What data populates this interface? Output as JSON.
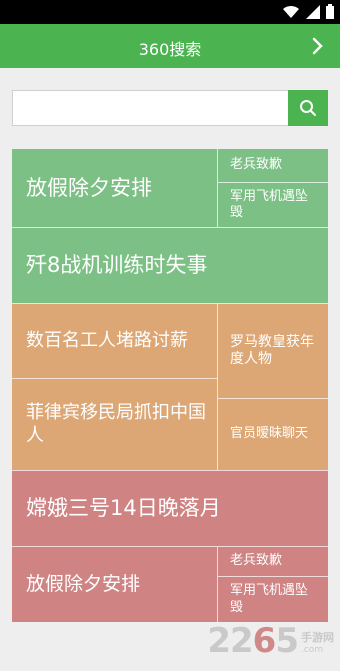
{
  "header": {
    "title": "360搜索"
  },
  "search": {
    "value": "",
    "placeholder": ""
  },
  "tiles": [
    {
      "text": "放假除夕安排"
    },
    {
      "text": "老兵致歉"
    },
    {
      "text": "军用飞机遇坠毁"
    },
    {
      "text": "歼8战机训练时失事"
    },
    {
      "text": "数百名工人堵路讨薪"
    },
    {
      "text": "罗马教皇获年度人物"
    },
    {
      "text": "菲律宾移民局抓扣中国人"
    },
    {
      "text": "官员暧昧聊天"
    },
    {
      "text": "嫦娥三号14日晚落月"
    },
    {
      "text": "放假除夕安排"
    },
    {
      "text": "老兵致歉"
    },
    {
      "text": "军用飞机遇坠毁"
    }
  ],
  "watermark": {
    "number": "2265",
    "suffix": "手游网",
    "domain": ".com"
  },
  "colors": {
    "accent": "#4cb351",
    "green": "#7dc086",
    "orange": "#dca675",
    "red": "#cf8383"
  }
}
